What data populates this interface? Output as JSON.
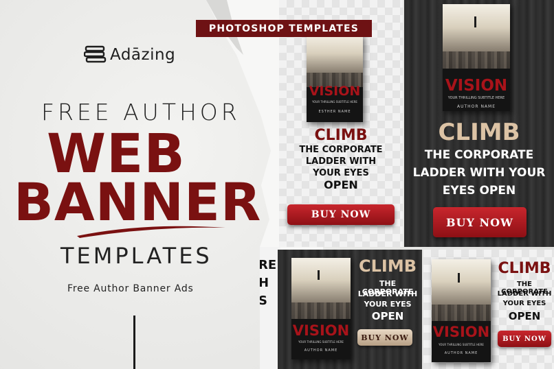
{
  "brand": {
    "name": "Adāzing",
    "icon": "books-stack-icon"
  },
  "headline": {
    "line1": "FREE AUTHOR",
    "line2": "WEB",
    "line3": "BANNER",
    "line4": "TEMPLATES",
    "subtitle": "Free Author Banner Ads"
  },
  "ribbon": {
    "label": "PHOTOSHOP TEMPLATES"
  },
  "book": {
    "title": "VISION",
    "subtitle": "YOUR THRILLING SUBTITLE HERE",
    "author": "AUTHOR NAME",
    "author_small": "ESTHER NAME"
  },
  "ad": {
    "headline1": "CLIMB",
    "headline2": "THE CORPORATE LADDER WITH YOUR EYES OPEN",
    "cta": "BUY NOW",
    "line_a": "THE CORPORATE",
    "line_b": "LADDER WITH",
    "line_c": "YOUR EYES",
    "line_d": "OPEN",
    "line_ladder_your": "LADDER WITH YOUR",
    "line_eyes_open": "EYES OPEN"
  },
  "fragment": {
    "lines": [
      "RE",
      "H",
      "S"
    ]
  },
  "colors": {
    "brand_red": "#7a1111",
    "ribbon": "#6e1214",
    "button_red": "#b81c22",
    "button_tan": "#cdb79c"
  }
}
